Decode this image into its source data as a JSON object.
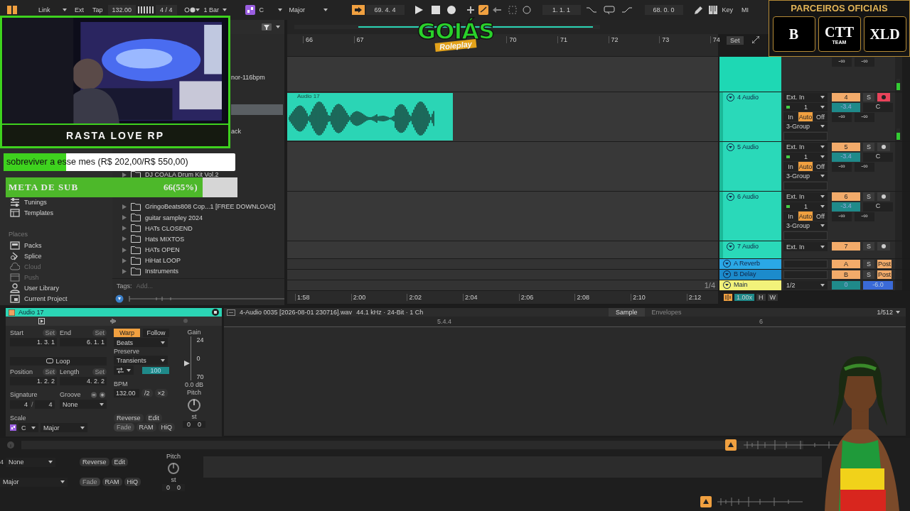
{
  "toolbar": {
    "link": "Link",
    "ext": "Ext",
    "tap": "Tap",
    "tempo": "132.00",
    "signature": "4 / 4",
    "quantization": "1 Bar",
    "scale_root": "C",
    "scale_mode": "Major",
    "follow": true,
    "position": "69. 4. 4",
    "loop_start": "1. 1. 1",
    "loop_length": "68. 0. 0",
    "key": "Key",
    "midi": "MI"
  },
  "browser": {
    "sidebar": [
      {
        "kind": "item",
        "label": "Tunings",
        "disabled": false
      },
      {
        "kind": "item",
        "label": "Templates",
        "disabled": false
      },
      {
        "kind": "header",
        "label": "Places"
      },
      {
        "kind": "item",
        "label": "Packs",
        "disabled": false
      },
      {
        "kind": "item",
        "label": "Splice",
        "disabled": false
      },
      {
        "kind": "item",
        "label": "Cloud",
        "disabled": true
      },
      {
        "kind": "item",
        "label": "Push",
        "disabled": true
      },
      {
        "kind": "item",
        "label": "User Library",
        "disabled": false
      },
      {
        "kind": "item",
        "label": "Current Project",
        "disabled": false
      }
    ],
    "files": [
      {
        "kind": "file",
        "name": "nor-116bpm",
        "selected": false
      },
      {
        "kind": "file",
        "selected": true
      },
      {
        "kind": "file",
        "name": "ack",
        "selected": false
      },
      {
        "kind": "folder",
        "name": "DJ COALA Drum Kit Vol.2",
        "selected": false
      },
      {
        "kind": "folder",
        "name": "GringoBeats808 Cop...1 [FREE DOWNLOAD]",
        "selected": false
      },
      {
        "kind": "folder",
        "name": "guitar sampley 2024",
        "selected": false
      },
      {
        "kind": "folder",
        "name": "HATs CLOSEND",
        "selected": false
      },
      {
        "kind": "folder",
        "name": "Hats MIXTOS",
        "selected": false
      },
      {
        "kind": "folder",
        "name": "HATs OPEN",
        "selected": false
      },
      {
        "kind": "folder",
        "name": "HiHat LOOP",
        "selected": false
      },
      {
        "kind": "folder",
        "name": "Instruments",
        "selected": false
      }
    ],
    "tags_label": "Tags:",
    "tags_placeholder": "Add..."
  },
  "arrangement": {
    "bars": [
      "66",
      "67",
      "70",
      "71",
      "72",
      "73",
      "74"
    ],
    "set_button": "Set",
    "times": [
      "1:58",
      "2:00",
      "2:02",
      "2:04",
      "2:06",
      "2:08",
      "2:10",
      "2:12"
    ],
    "grid": "1/4",
    "zoom": "1.00x",
    "h_button": "H",
    "w_button": "W"
  },
  "tracks": [
    {
      "kind": "partial",
      "color": "#1ed8b4",
      "sends": [
        "-∞",
        "-∞"
      ]
    },
    {
      "kind": "audio",
      "name": "4 Audio",
      "color": "#2ad9b9",
      "input": "Ext. In",
      "channel": "1",
      "monitor": [
        {
          "label": "In",
          "selected": false
        },
        {
          "label": "Auto",
          "selected": true
        },
        {
          "label": "Off",
          "selected": false
        }
      ],
      "output": "3-Group",
      "number": "4",
      "solo": "S",
      "armed": true,
      "volume": "-3.4",
      "pan": "C",
      "sends": [
        "-∞",
        "-∞"
      ],
      "clips": [
        {
          "name": "Audio 17",
          "color": "#2bd5b5"
        }
      ]
    },
    {
      "kind": "audio",
      "name": "5 Audio",
      "color": "#2ad9b9",
      "input": "Ext. In",
      "channel": "1",
      "monitor": [
        {
          "label": "In",
          "selected": false
        },
        {
          "label": "Auto",
          "selected": true
        },
        {
          "label": "Off",
          "selected": false
        }
      ],
      "output": "3-Group",
      "number": "5",
      "solo": "S",
      "armed": false,
      "volume": "-3.4",
      "pan": "C",
      "sends": [
        "-∞",
        "-∞"
      ]
    },
    {
      "kind": "audio",
      "name": "6 Audio",
      "color": "#2ad9b9",
      "input": "Ext. In",
      "channel": "1",
      "monitor": [
        {
          "label": "In",
          "selected": false
        },
        {
          "label": "Auto",
          "selected": true
        },
        {
          "label": "Off",
          "selected": false
        }
      ],
      "output": "3-Group",
      "number": "6",
      "solo": "S",
      "armed": false,
      "volume": "-3.4",
      "pan": "C",
      "sends": [
        "-∞",
        "-∞"
      ]
    },
    {
      "kind": "audio",
      "name": "7 Audio",
      "color": "#2ad9b9",
      "input": "Ext. In",
      "number": "7",
      "solo": "S",
      "armed": false
    },
    {
      "kind": "return",
      "name": "A Reverb",
      "color": "#2aa8e6",
      "letter": "A",
      "solo": "S",
      "post": "Post"
    },
    {
      "kind": "return",
      "name": "B Delay",
      "color": "#1c8bcc",
      "letter": "B",
      "solo": "S",
      "post": "Post"
    },
    {
      "kind": "main",
      "name": "Main",
      "color": "#f2f27a",
      "output": "1/2",
      "volume": "0",
      "cue_volume": "-6.0"
    }
  ],
  "clip_view": {
    "title": "Audio 17",
    "start": {
      "label": "Start",
      "set": "Set",
      "value": "1. 3. 1"
    },
    "end": {
      "label": "End",
      "set": "Set",
      "value": "6. 1. 1"
    },
    "loop": {
      "label": "Loop",
      "on": false
    },
    "position": {
      "label": "Position",
      "set": "Set",
      "value": "1. 2. 2"
    },
    "length": {
      "label": "Length",
      "set": "Set",
      "value": "4. 2. 2"
    },
    "signature": {
      "label": "Signature",
      "numerator": "4",
      "separator": "/",
      "denominator": "4"
    },
    "groove": {
      "label": "Groove",
      "value": "None"
    },
    "scale": {
      "label": "Scale",
      "root": "C",
      "mode": "Major"
    },
    "warp": {
      "label": "Warp",
      "on": true
    },
    "follow": {
      "label": "Follow",
      "on": false
    },
    "warp_mode": "Beats",
    "preserve_label": "Preserve",
    "preserve": "Transients",
    "envelope": "100",
    "bpm_label": "BPM",
    "bpm": "132.00",
    "halve": "/2",
    "double": "×2",
    "reverse": "Reverse",
    "edit": "Edit",
    "fade": {
      "label": "Fade",
      "on": false
    },
    "ram": "RAM",
    "hiq": "HiQ",
    "gain": {
      "label": "Gain",
      "ticks": [
        "24",
        "0",
        "70"
      ],
      "level": 0.39,
      "value": "0.0 dB"
    },
    "pitch": {
      "label": "Pitch",
      "unit": "st",
      "values": [
        "0",
        "0"
      ]
    }
  },
  "sample_editor": {
    "file": "4-Audio 0035 [2026-08-01 230716].wav",
    "info": "44.1 kHz · 24-Bit · 1 Ch",
    "tabs": [
      {
        "label": "Sample",
        "selected": true
      },
      {
        "label": "Envelopes",
        "selected": false
      }
    ],
    "zoom": "1/512",
    "markers": [
      "5.4.4",
      "6"
    ]
  },
  "ghost": {
    "pitch_label": "Pitch",
    "numerator": "4",
    "groove": "None",
    "reverse": "Reverse",
    "edit": "Edit",
    "pitch_unit": "st",
    "scale_mode": "Major",
    "fade": "Fade",
    "ram": "RAM",
    "hiq": "HiQ",
    "pitch": [
      "0",
      "0"
    ]
  },
  "overlays": {
    "webcam": {
      "kind": "picture",
      "caption": "RASTA LOVE RP"
    },
    "donation_goal": {
      "text": "sobreviver a esse mes (R$ 202,00/R$ 550,00)",
      "level": 0.27
    },
    "sub_goal": {
      "label": "META DE SUB",
      "count": "66(55%)",
      "level": 0.85
    },
    "server_logo": {
      "title": "GOIÁS",
      "subtitle": "Roleplay"
    },
    "partners": {
      "title": "PARCEIROS OFICIAIS",
      "logos": [
        {
          "main": "B"
        },
        {
          "main": "CTT",
          "sub": "TEAM"
        },
        {
          "main": "XLD"
        }
      ]
    }
  }
}
